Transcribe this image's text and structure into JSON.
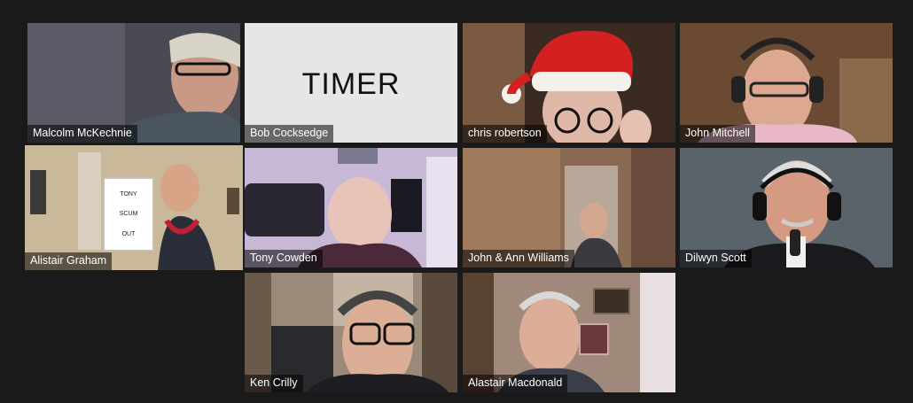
{
  "participants": [
    {
      "name": "Malcolm McKechnie",
      "active": false
    },
    {
      "name": "Bob Cocksedge",
      "active": false,
      "screen_text": "TIMER"
    },
    {
      "name": "chris robertson",
      "active": false
    },
    {
      "name": "John Mitchell",
      "active": false
    },
    {
      "name": "Alistair Graham",
      "active": true,
      "sign_lines": [
        "TONY",
        "SCUM",
        "OUT"
      ]
    },
    {
      "name": "Tony Cowden",
      "active": false
    },
    {
      "name": "John & Ann Williams",
      "active": false
    },
    {
      "name": "Dilwyn Scott",
      "active": false
    },
    {
      "name": "Ken Crilly",
      "active": false
    },
    {
      "name": "Alastair Macdonald",
      "active": false
    }
  ],
  "colors": {
    "background": "#1a1a1a",
    "active_speaker_border": "#d4e157",
    "name_label_bg": "rgba(0,0,0,0.55)",
    "name_label_text": "#ffffff"
  }
}
